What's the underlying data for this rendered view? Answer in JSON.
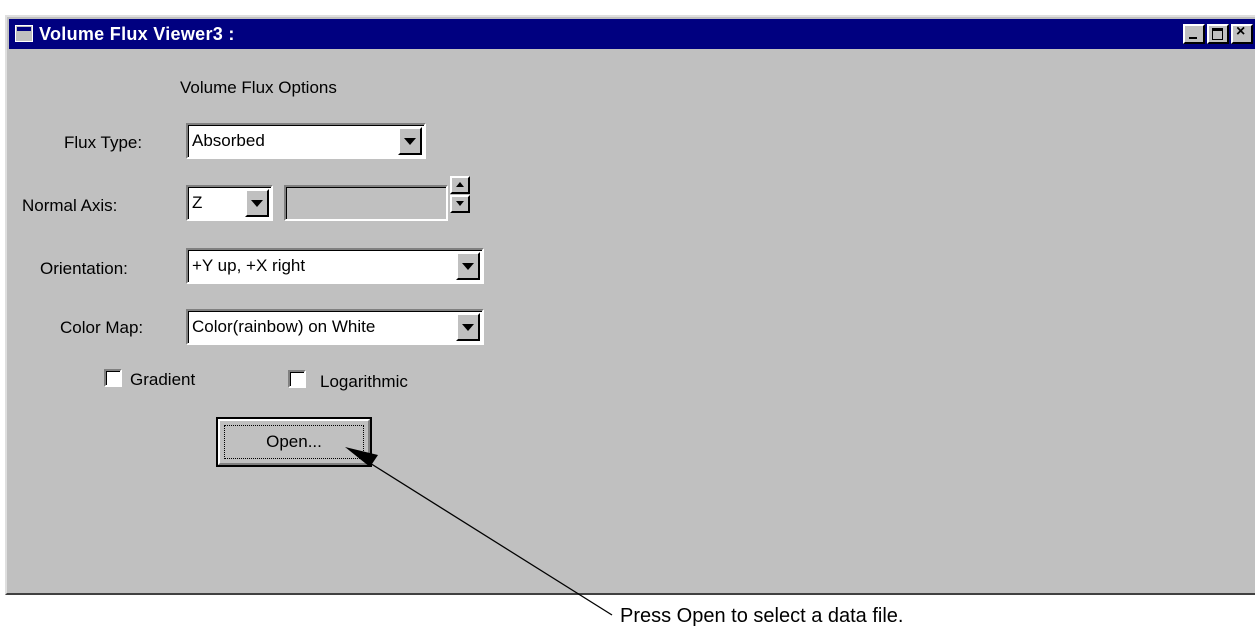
{
  "window": {
    "title": "Volume Flux Viewer3 :"
  },
  "panel": {
    "heading": "Volume Flux Options",
    "flux_type": {
      "label": "Flux Type:",
      "value": "Absorbed"
    },
    "normal_axis": {
      "label": "Normal Axis:",
      "value": "Z",
      "position_value": ""
    },
    "orientation": {
      "label": "Orientation:",
      "value": "+Y up, +X right"
    },
    "color_map": {
      "label": "Color Map:",
      "value": "Color(rainbow) on White"
    },
    "gradient": {
      "label": "Gradient",
      "checked": false
    },
    "logarithmic": {
      "label": "Logarithmic",
      "checked": false
    },
    "open_button": "Open..."
  },
  "annotation": {
    "text": "Press Open to select a data file."
  },
  "colors": {
    "titlebar": "#000080",
    "face": "#c0c0c0"
  }
}
